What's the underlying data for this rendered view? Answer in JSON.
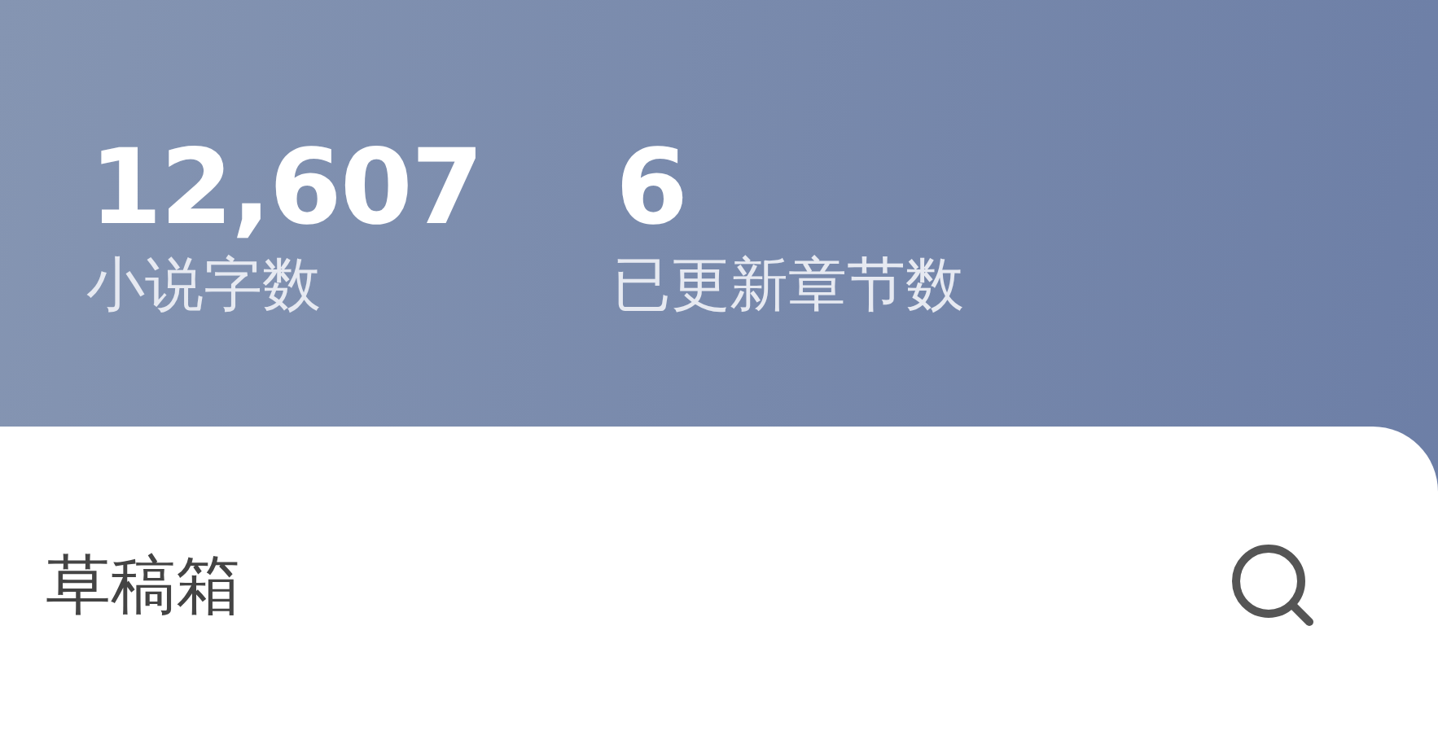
{
  "stats": [
    {
      "value": "12,607",
      "label": "小说字数"
    },
    {
      "value": "6",
      "label": "已更新章节数"
    }
  ],
  "section": {
    "title": "草稿箱"
  }
}
